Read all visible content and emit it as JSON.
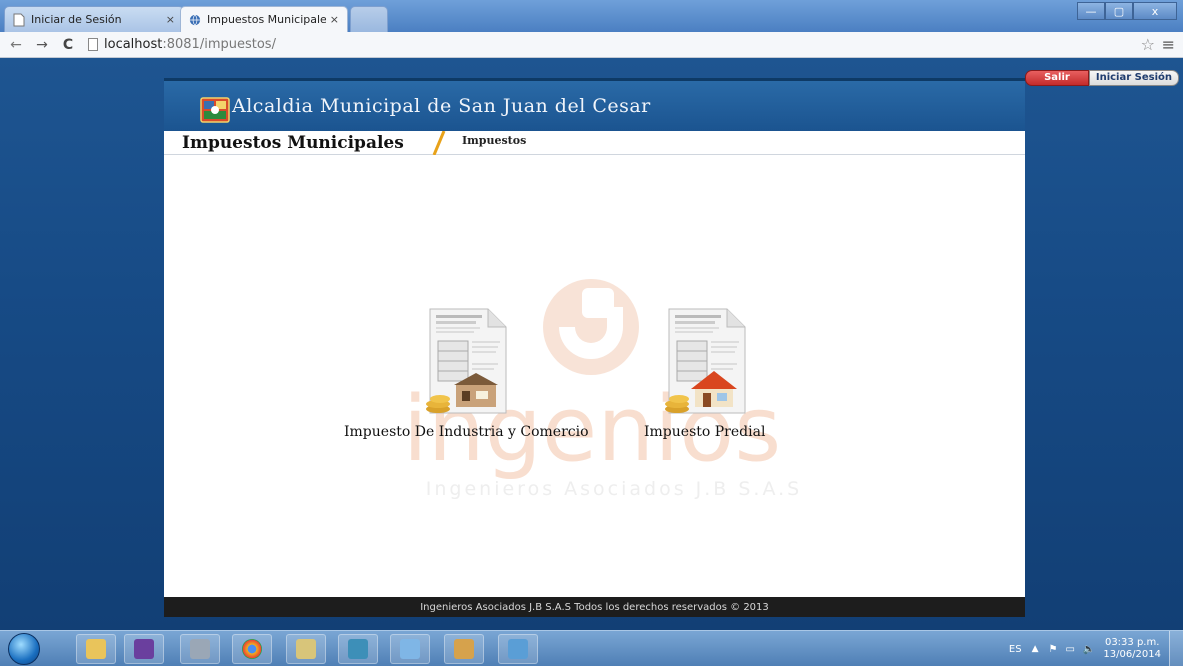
{
  "browser": {
    "tabs": [
      {
        "label": "Iniciar de Sesión",
        "active": false
      },
      {
        "label": "Impuestos Municipales",
        "active": true
      }
    ],
    "close_glyph": "×",
    "url_host": "localhost",
    "url_rest": ":8081/impuestos/",
    "icons": {
      "back": "←",
      "forward": "→",
      "reload": "C",
      "star": "☆",
      "menu": "≡"
    },
    "window_buttons": {
      "minimize": "—",
      "maximize": "▢",
      "close": "x"
    }
  },
  "session": {
    "logout": "Salir",
    "login": "Iniciar Sesión"
  },
  "site": {
    "title": "Alcaldia Municipal de San Juan del Cesar",
    "section": "Impuestos Municipales",
    "breadcrumb": "Impuestos",
    "taxes": [
      {
        "label": "Impuesto De Industria y Comercio",
        "icon": "industry-tax-document-icon"
      },
      {
        "label": "Impuesto Predial",
        "icon": "property-tax-document-icon"
      }
    ],
    "watermark": {
      "brand": "ingenios",
      "tagline": "Ingenieros Asociados J.B S.A.S"
    },
    "footer": "Ingenieros Asociados J.B S.A.S Todos los derechos reservados © 2013",
    "colors": {
      "banner": "#1b5490",
      "accent_slash": "#e8a21a",
      "footer": "#1d1d1d",
      "watermark": "#f3c9b3"
    }
  },
  "taskbar": {
    "apps": [
      "explorer-icon",
      "visual-studio-icon",
      "network-tool-icon",
      "chrome-icon",
      "sql-tool-icon",
      "media-icon",
      "glass-app-icon",
      "paint-icon",
      "photo-viewer-icon"
    ],
    "language": "ES",
    "time": "03:33 p.m.",
    "date": "13/06/2014"
  }
}
